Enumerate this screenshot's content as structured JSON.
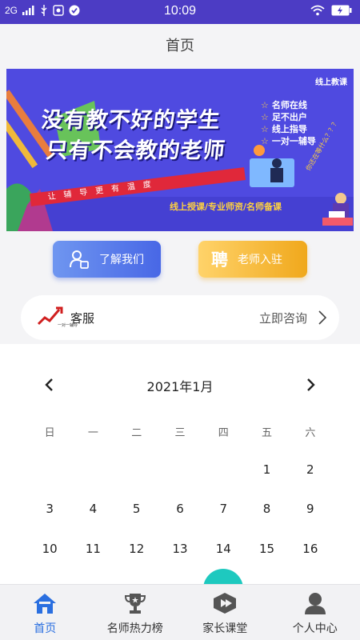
{
  "status_bar": {
    "network": "2G",
    "time": "10:09"
  },
  "page_title": "首页",
  "banner": {
    "tag": "线上教课",
    "headline_1": "没有教不好的学生",
    "headline_2": "只有不会教的老师",
    "ribbon": "让辅导更有温度",
    "features": [
      "名师在线",
      "足不出户",
      "线上指导",
      "一对一辅导"
    ],
    "bottom_line": "线上授课/专业师资/名师备课",
    "side_note": "你还在等什么？？？"
  },
  "actions": {
    "about_label": "了解我们",
    "join_icon_char": "聘",
    "join_label": "老师入驻"
  },
  "service": {
    "logo_text": "一对一辅导",
    "label": "客服",
    "consult_label": "立即咨询"
  },
  "calendar": {
    "month_label": "2021年1月",
    "weekdays": [
      "日",
      "一",
      "二",
      "三",
      "四",
      "五",
      "六"
    ],
    "weeks": [
      [
        "",
        "",
        "",
        "",
        "",
        "1",
        "2"
      ],
      [
        "3",
        "4",
        "5",
        "6",
        "7",
        "8",
        "9"
      ],
      [
        "10",
        "11",
        "12",
        "13",
        "14",
        "15",
        "16"
      ]
    ]
  },
  "tabbar": {
    "items": [
      {
        "label": "首页",
        "icon": "home-icon",
        "active": true
      },
      {
        "label": "名师热力榜",
        "icon": "trophy-icon",
        "active": false
      },
      {
        "label": "家长课堂",
        "icon": "course-icon",
        "active": false
      },
      {
        "label": "个人中心",
        "icon": "profile-icon",
        "active": false
      }
    ]
  },
  "colors": {
    "status_bar": "#4c3cc4",
    "banner_bg": "#4f4ae0",
    "about_button": "#4867e6",
    "join_button": "#f0a81c",
    "tab_active": "#2a6fe0",
    "fab": "#1ec9bf"
  }
}
